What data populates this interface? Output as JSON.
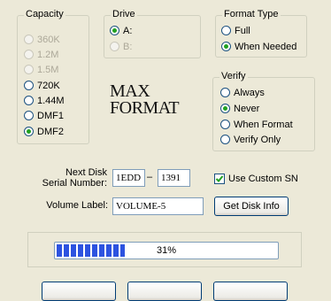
{
  "capacity": {
    "title": "Capacity",
    "options": [
      {
        "label": "360K",
        "checked": false,
        "enabled": false
      },
      {
        "label": "1.2M",
        "checked": false,
        "enabled": false
      },
      {
        "label": "1.5M",
        "checked": false,
        "enabled": false
      },
      {
        "label": "720K",
        "checked": false,
        "enabled": true
      },
      {
        "label": "1.44M",
        "checked": false,
        "enabled": true
      },
      {
        "label": "DMF1",
        "checked": false,
        "enabled": true
      },
      {
        "label": "DMF2",
        "checked": true,
        "enabled": true
      }
    ]
  },
  "drive": {
    "title": "Drive",
    "options": [
      {
        "label": "A:",
        "checked": true,
        "enabled": true
      },
      {
        "label": "B:",
        "checked": false,
        "enabled": false
      }
    ]
  },
  "format_type": {
    "title": "Format Type",
    "options": [
      {
        "label": "Full",
        "checked": false
      },
      {
        "label": "When Needed",
        "checked": true
      }
    ]
  },
  "verify": {
    "title": "Verify",
    "options": [
      {
        "label": "Always",
        "checked": false
      },
      {
        "label": "Never",
        "checked": true
      },
      {
        "label": "When Format",
        "checked": false
      },
      {
        "label": "Verify Only",
        "checked": false
      }
    ]
  },
  "logo": {
    "line1": "MAX",
    "line2": "FORMAT"
  },
  "serial": {
    "label_line1": "Next Disk",
    "label_line2": "Serial Number:",
    "part1": "1EDD",
    "separator": "–",
    "part2": "1391",
    "custom_sn_label": "Use Custom SN",
    "custom_sn_checked": true
  },
  "volume": {
    "label": "Volume Label:",
    "value": "VOLUME-5",
    "get_disk_info_label": "Get Disk Info"
  },
  "progress": {
    "percent": 31,
    "text": "31%"
  },
  "colors": {
    "accent": "#21A121",
    "progress": "#2D53E0",
    "background": "#ECE9D8"
  }
}
